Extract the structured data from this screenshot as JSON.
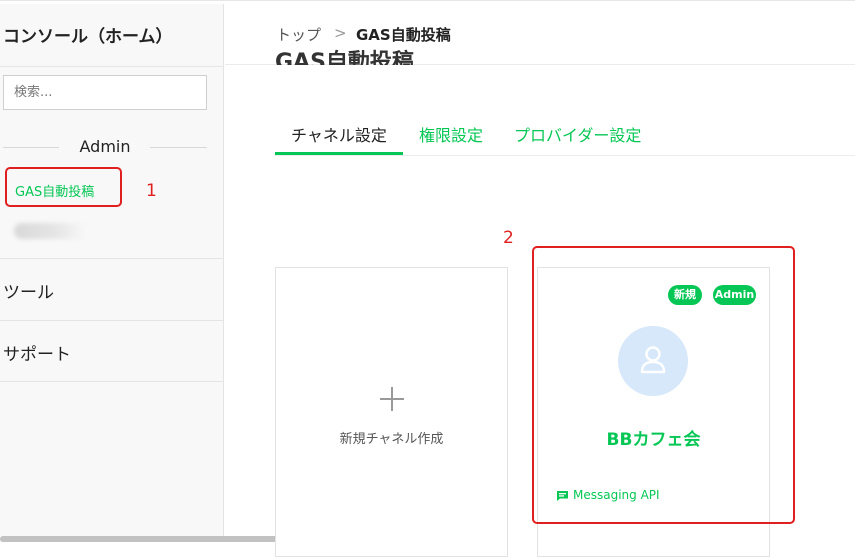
{
  "sidebar": {
    "title": "コンソール（ホーム）",
    "search_placeholder": "検索...",
    "section_admin": "Admin",
    "items": [
      {
        "label": "GAS自動投稿"
      }
    ],
    "sections": [
      {
        "label": "ツール"
      },
      {
        "label": "サポート"
      }
    ]
  },
  "header": {
    "breadcrumb": [
      "トップ",
      ">",
      "GAS自動投稿"
    ],
    "page_title": "GAS自動投稿"
  },
  "tabs": [
    {
      "label": "チャネル設定",
      "active": true
    },
    {
      "label": "権限設定",
      "active": false
    },
    {
      "label": "プロバイダー設定",
      "active": false
    }
  ],
  "cards": {
    "new_channel_label": "新規チャネル作成",
    "channel": {
      "badges": [
        "新規",
        "Admin"
      ],
      "name": "BBカフェ会",
      "api_type": "Messaging API"
    }
  },
  "annotations": [
    "1",
    "2"
  ],
  "colors": {
    "accent": "#06c755",
    "annotation": "#e02020",
    "avatar_bg": "#d7e8fb"
  },
  "icons": {
    "plus": "plus-icon",
    "avatar": "user-icon",
    "api": "chat-bubble-icon"
  }
}
